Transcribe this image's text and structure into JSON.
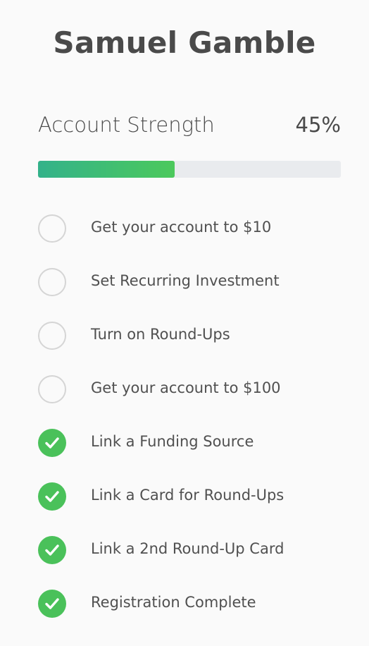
{
  "profile": {
    "name": "Samuel Gamble"
  },
  "strength": {
    "label": "Account Strength",
    "percent_text": "45%",
    "progress": 0.45,
    "colors": {
      "fill_start": "#33b28a",
      "fill_end": "#4cc95c",
      "track": "#e9ebee"
    }
  },
  "checklist": {
    "items": [
      {
        "label": "Get your account to $10",
        "done": false
      },
      {
        "label": "Set Recurring Investment",
        "done": false
      },
      {
        "label": "Turn on Round-Ups",
        "done": false
      },
      {
        "label": "Get your account to $100",
        "done": false
      },
      {
        "label": "Link a Funding Source",
        "done": true,
        "icon": "check-icon"
      },
      {
        "label": "Link a Card for Round-Ups",
        "done": true,
        "icon": "check-icon"
      },
      {
        "label": "Link a 2nd Round-Up Card",
        "done": true,
        "icon": "check-icon"
      },
      {
        "label": "Registration Complete",
        "done": true,
        "icon": "check-icon"
      }
    ],
    "colors": {
      "done": "#4ac15a",
      "todo_border": "#d5d5d5"
    }
  }
}
